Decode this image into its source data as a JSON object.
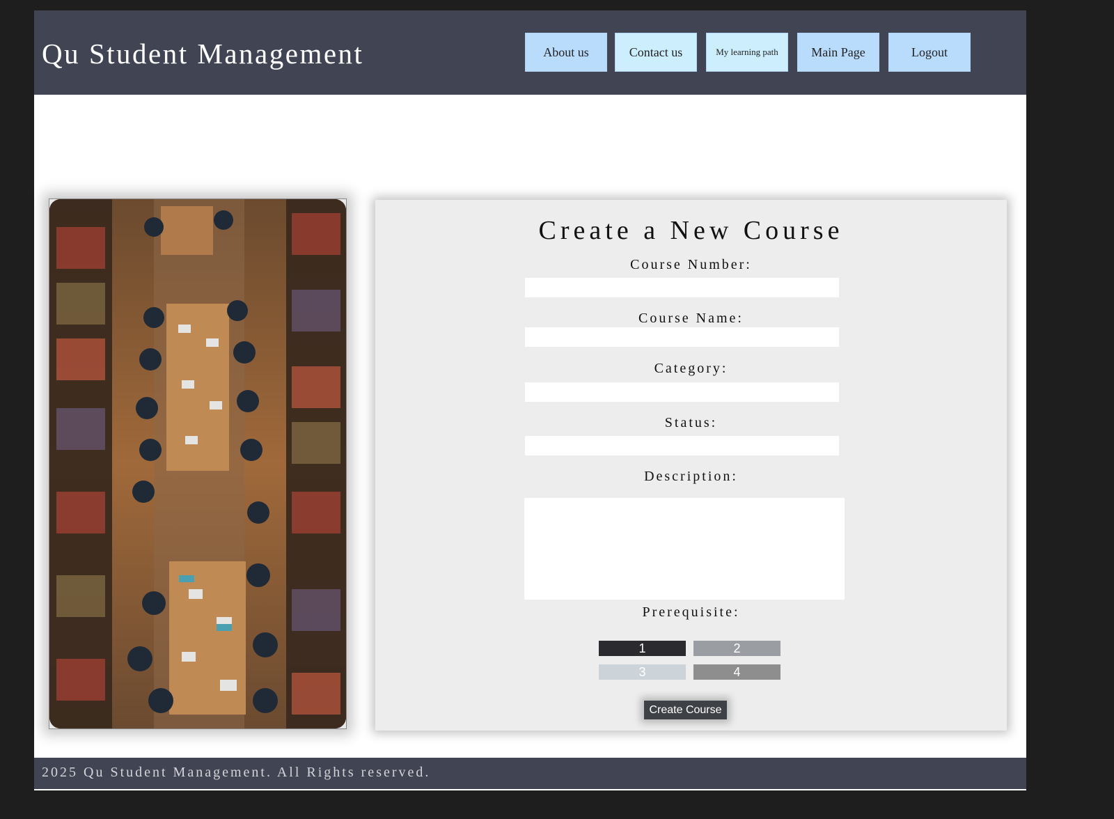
{
  "header": {
    "brand": "Qu Student Management",
    "nav": [
      {
        "label": "About us",
        "bg": "#b9dcfd"
      },
      {
        "label": "Contact us",
        "bg": "#cdeefd"
      },
      {
        "label": "My learning path",
        "bg": "#cdeefd"
      },
      {
        "label": "Main Page",
        "bg": "#b9dcfd"
      },
      {
        "label": "Logout",
        "bg": "#b9dcfd"
      }
    ]
  },
  "form": {
    "title": "Create a New Course",
    "course_number_label": "Course Number:",
    "course_number_value": "",
    "course_name_label": "Course Name:",
    "course_name_value": "",
    "category_label": "Category:",
    "category_value": "",
    "status_label": "Status:",
    "status_value": "",
    "description_label": "Description:",
    "description_value": "",
    "prerequisite_label": "Prerequisite:",
    "prerequisites": [
      {
        "label": "1",
        "color": "#2b2b2f"
      },
      {
        "label": "2",
        "color": "#9a9ea2"
      },
      {
        "label": "3",
        "color": "#ccd4da"
      },
      {
        "label": "4",
        "color": "#8e8e8e"
      }
    ],
    "submit_label": "Create Course"
  },
  "image": {
    "icon": "library-study-hall-photo"
  },
  "footer": {
    "text": "2025 Qu Student Management. All Rights reserved."
  },
  "colors": {
    "header_bg": "#414553",
    "card_bg": "#ededed",
    "outer_bg": "#1e1e1e"
  }
}
